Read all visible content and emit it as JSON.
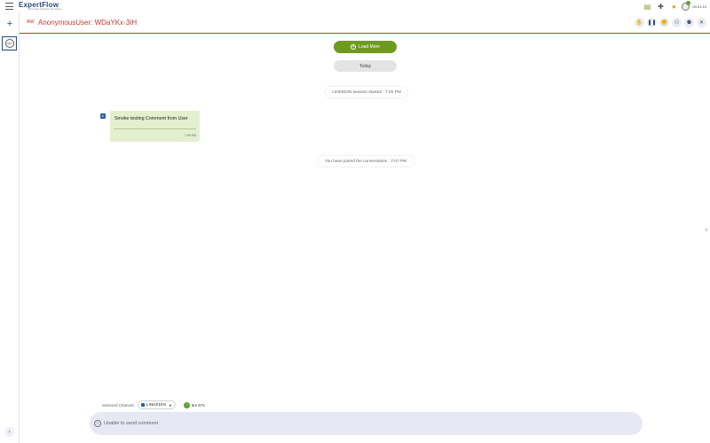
{
  "app": {
    "logo_text": "ExpertFlow",
    "logo_subtitle": "connecting customers and agents"
  },
  "topbar": {
    "status_time": "00:01:10"
  },
  "conversation": {
    "initials": "AW",
    "title": "AnonymousUser: WDaYKx-3IH"
  },
  "main": {
    "load_more_label": "Load More",
    "date_separator": "Today",
    "system_messages": [
      "LINKEDIN session started : 7:05 PM",
      "You have joined the conversation : 7:07 PM"
    ],
    "message": {
      "channel_icon": "in",
      "text": "Smoke testing Comment from User",
      "time": "7:05 PM"
    }
  },
  "channel_bar": {
    "label": "Selected Channel:",
    "selected": "LINKEDIN",
    "timer": "8m 57s"
  },
  "composer": {
    "placeholder": "Unable to send comment"
  },
  "colors": {
    "accent_green": "#6f9a1f",
    "header_red": "#c0392b",
    "brand_blue": "#2b4a7a",
    "bubble_green": "#e4efcf"
  }
}
